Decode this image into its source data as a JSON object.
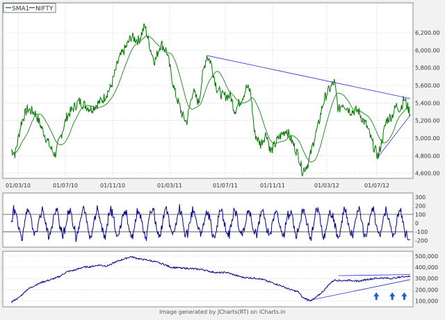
{
  "legend": {
    "items": [
      {
        "label": "SMA1",
        "color": "#2e8b2e"
      },
      {
        "label": "NIFTY",
        "color": "#2e8b2e"
      }
    ]
  },
  "footer": {
    "credit": "Image generated by JCharts(RT) on iCharts.in"
  },
  "colors": {
    "price": "#007700",
    "sma": "#2e8b2e",
    "indicator": "#00008b",
    "trendline": "#2b2bd8",
    "arrow": "#1f5fd6",
    "background": "#ffffff",
    "grid": "#cfcfcf"
  },
  "chart_data": [
    {
      "type": "line",
      "x_ticks": [
        "01/03/10",
        "01/07/10",
        "01/11/10",
        "01/03/11",
        "01/07/11",
        "01/11/11",
        "01/03/12",
        "01/07/12"
      ],
      "y_ticks": [
        "4,600.00",
        "4,800.00",
        "5,000.00",
        "5,200.00",
        "5,400.00",
        "5,600.00",
        "5,800.00",
        "6,000.00",
        "6,200.00"
      ],
      "ylim": [
        4550,
        6350
      ],
      "grid": true,
      "legend_position": "top-left",
      "price_anchors": [
        [
          0.0,
          4870
        ],
        [
          0.01,
          4820
        ],
        [
          0.025,
          5170
        ],
        [
          0.04,
          5330
        ],
        [
          0.06,
          5290
        ],
        [
          0.08,
          5080
        ],
        [
          0.1,
          4880
        ],
        [
          0.11,
          4810
        ],
        [
          0.14,
          5250
        ],
        [
          0.17,
          5420
        ],
        [
          0.2,
          5330
        ],
        [
          0.23,
          5440
        ],
        [
          0.25,
          5580
        ],
        [
          0.27,
          5900
        ],
        [
          0.29,
          6050
        ],
        [
          0.3,
          6150
        ],
        [
          0.32,
          6110
        ],
        [
          0.335,
          6280
        ],
        [
          0.35,
          6000
        ],
        [
          0.36,
          5870
        ],
        [
          0.375,
          6080
        ],
        [
          0.39,
          5990
        ],
        [
          0.4,
          5750
        ],
        [
          0.41,
          5530
        ],
        [
          0.43,
          5250
        ],
        [
          0.44,
          5180
        ],
        [
          0.455,
          5540
        ],
        [
          0.47,
          5400
        ],
        [
          0.48,
          5720
        ],
        [
          0.49,
          5940
        ],
        [
          0.5,
          5870
        ],
        [
          0.515,
          5570
        ],
        [
          0.53,
          5480
        ],
        [
          0.55,
          5480
        ],
        [
          0.56,
          5310
        ],
        [
          0.58,
          5470
        ],
        [
          0.59,
          5580
        ],
        [
          0.6,
          5530
        ],
        [
          0.61,
          5050
        ],
        [
          0.625,
          4930
        ],
        [
          0.64,
          5060
        ],
        [
          0.65,
          4840
        ],
        [
          0.67,
          5000
        ],
        [
          0.69,
          5100
        ],
        [
          0.71,
          4900
        ],
        [
          0.72,
          4800
        ],
        [
          0.73,
          4620
        ],
        [
          0.745,
          4720
        ],
        [
          0.76,
          5000
        ],
        [
          0.77,
          5150
        ],
        [
          0.78,
          5370
        ],
        [
          0.79,
          5500
        ],
        [
          0.81,
          5640
        ],
        [
          0.82,
          5310
        ],
        [
          0.83,
          5400
        ],
        [
          0.85,
          5310
        ],
        [
          0.87,
          5310
        ],
        [
          0.88,
          5220
        ],
        [
          0.89,
          5150
        ],
        [
          0.91,
          4880
        ],
        [
          0.92,
          4790
        ],
        [
          0.935,
          5090
        ],
        [
          0.94,
          5200
        ],
        [
          0.955,
          5260
        ],
        [
          0.965,
          5370
        ],
        [
          0.975,
          5330
        ],
        [
          0.985,
          5450
        ],
        [
          1.0,
          5280
        ]
      ],
      "trendlines": [
        {
          "from": [
            0.49,
            5940
          ],
          "to": [
            1.0,
            5450
          ]
        },
        {
          "from": [
            0.92,
            4790
          ],
          "to": [
            1.0,
            5260
          ]
        }
      ]
    },
    {
      "type": "line",
      "y_ticks": [
        "300",
        "200",
        "100",
        "0",
        "-100",
        "-200"
      ],
      "ylim": [
        -260,
        330
      ],
      "reference_lines": [
        100,
        -100
      ],
      "oscillator_phase_count": 58,
      "oscillator_amplitude": 160,
      "final_value": -190
    },
    {
      "type": "line",
      "y_ticks": [
        "500,000",
        "400,000",
        "300,000",
        "200,000",
        "100,000"
      ],
      "ylim": [
        60000,
        530000
      ],
      "grid": true,
      "anchors": [
        [
          0.0,
          90000
        ],
        [
          0.02,
          130000
        ],
        [
          0.04,
          200000
        ],
        [
          0.06,
          240000
        ],
        [
          0.08,
          270000
        ],
        [
          0.1,
          290000
        ],
        [
          0.12,
          315000
        ],
        [
          0.14,
          360000
        ],
        [
          0.16,
          375000
        ],
        [
          0.18,
          400000
        ],
        [
          0.2,
          405000
        ],
        [
          0.22,
          420000
        ],
        [
          0.24,
          410000
        ],
        [
          0.26,
          445000
        ],
        [
          0.28,
          470000
        ],
        [
          0.3,
          495000
        ],
        [
          0.32,
          475000
        ],
        [
          0.34,
          465000
        ],
        [
          0.36,
          450000
        ],
        [
          0.38,
          430000
        ],
        [
          0.4,
          400000
        ],
        [
          0.42,
          395000
        ],
        [
          0.44,
          390000
        ],
        [
          0.46,
          385000
        ],
        [
          0.48,
          380000
        ],
        [
          0.5,
          360000
        ],
        [
          0.52,
          350000
        ],
        [
          0.54,
          355000
        ],
        [
          0.56,
          330000
        ],
        [
          0.58,
          310000
        ],
        [
          0.6,
          305000
        ],
        [
          0.62,
          300000
        ],
        [
          0.64,
          280000
        ],
        [
          0.66,
          255000
        ],
        [
          0.68,
          230000
        ],
        [
          0.7,
          200000
        ],
        [
          0.72,
          180000
        ],
        [
          0.73,
          130000
        ],
        [
          0.75,
          105000
        ],
        [
          0.76,
          120000
        ],
        [
          0.78,
          180000
        ],
        [
          0.8,
          260000
        ],
        [
          0.81,
          285000
        ],
        [
          0.83,
          280000
        ],
        [
          0.85,
          285000
        ],
        [
          0.87,
          275000
        ],
        [
          0.89,
          290000
        ],
        [
          0.91,
          300000
        ],
        [
          0.93,
          305000
        ],
        [
          0.95,
          300000
        ],
        [
          0.97,
          310000
        ],
        [
          0.99,
          320000
        ],
        [
          1.0,
          315000
        ]
      ],
      "trendlines": [
        {
          "from": [
            0.82,
            325000
          ],
          "to": [
            1.0,
            335000
          ]
        },
        {
          "from": [
            0.74,
            100000
          ],
          "to": [
            1.0,
            290000
          ]
        }
      ],
      "arrows_at": [
        0.915,
        0.955,
        0.985
      ]
    }
  ]
}
